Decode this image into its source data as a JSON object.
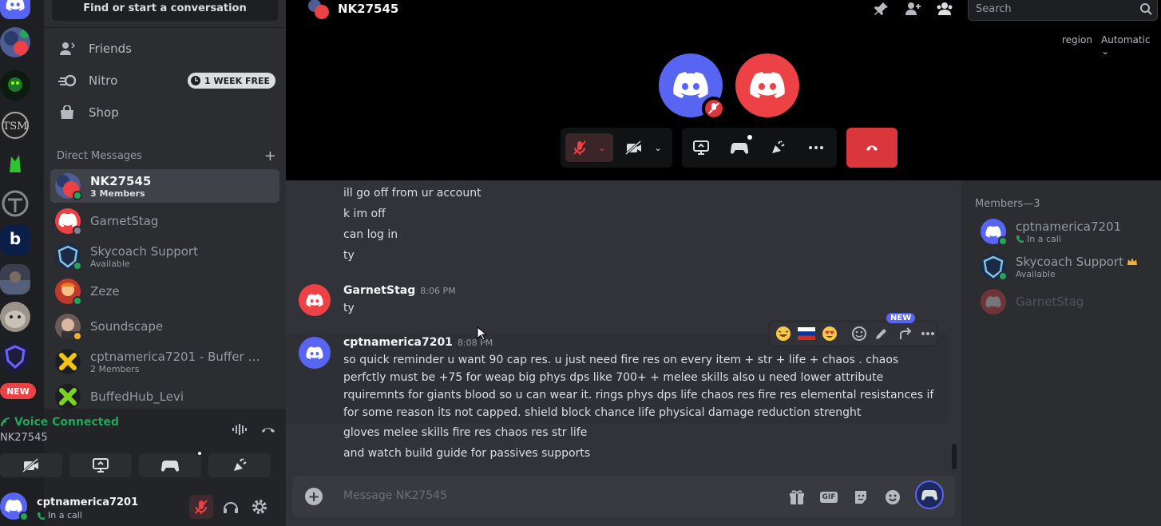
{
  "sidebar": {
    "find_label": "Find or start a conversation",
    "nav": [
      {
        "label": "Friends",
        "icon": "friends-icon"
      },
      {
        "label": "Nitro",
        "icon": "nitro-icon",
        "badge": "1 WEEK FREE"
      },
      {
        "label": "Shop",
        "icon": "shop-icon"
      }
    ],
    "dm_header": "Direct Messages",
    "dms": [
      {
        "name": "NK27545",
        "sub": "3 Members",
        "active": true
      },
      {
        "name": "GarnetStag",
        "sub": ""
      },
      {
        "name": "Skycoach Support",
        "sub": "Available"
      },
      {
        "name": "Zeze",
        "sub": ""
      },
      {
        "name": "Soundscape",
        "sub": ""
      },
      {
        "name": "cptnamerica7201 - Buffer Sup...",
        "sub": "2 Members"
      },
      {
        "name": "BuffedHub_Levi",
        "sub": ""
      }
    ],
    "new_badge": "NEW"
  },
  "voice": {
    "status": "Voice Connected",
    "channel": "NK27545"
  },
  "user": {
    "name": "cptnamerica7201",
    "status": "In a call"
  },
  "call": {
    "title": "NK27545",
    "search_placeholder": "Search",
    "region_label": "region",
    "region_value": "Automatic"
  },
  "messages": {
    "continued": [
      "ill go off from ur account",
      "k im off",
      "can log in",
      "ty"
    ],
    "msg1": {
      "author": "GarnetStag",
      "time": "8:06 PM",
      "text": "ty"
    },
    "msg2": {
      "author": "cptnamerica7201",
      "time": "8:08 PM",
      "text": "so quick reminder u want 90 cap res. u just need fire res on every item + str + life + chaos . chaos perfctly must be +75 for weap big phys dps like 700+ + melee skills also u need lower attribute rquiremnts for giants blood so u can wear it. rings phys dps life chaos res fire res elemental resistances if for some reason its not capped. shield block chance life physical damage reduction strenght",
      "follow": [
        "gloves melee skills fire res chaos res str life",
        "and watch build guide for passives supports"
      ]
    },
    "toolbar_new": "NEW"
  },
  "composer": {
    "placeholder": "Message NK27545",
    "gif_label": "GIF"
  },
  "members": {
    "header": "Members—3",
    "list": [
      {
        "name": "cptnamerica7201",
        "sub": "In a call"
      },
      {
        "name": "Skycoach Support",
        "sub": "Available"
      },
      {
        "name": "GarnetStag",
        "sub": ""
      }
    ]
  },
  "colors": {
    "blurple": "#5865f2",
    "red": "#ed4245",
    "green": "#23a55a",
    "hangup": "#da373c"
  }
}
